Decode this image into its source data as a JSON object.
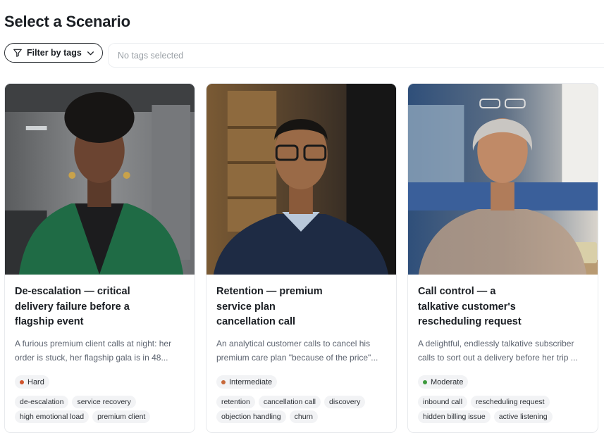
{
  "page": {
    "title": "Select a Scenario"
  },
  "filter": {
    "button_label": "Filter by tags",
    "placeholder": "No tags selected"
  },
  "colors": {
    "hard": "#d0542c",
    "intermediate": "#c7693a",
    "moderate": "#3d9a3d"
  },
  "cards": [
    {
      "title": "De-escalation — critical delivery failure before a flagship event",
      "description": "A furious premium client calls at night: her order is stuck, her flagship gala is in 48...",
      "difficulty": "Hard",
      "tags": [
        "de-escalation",
        "service recovery",
        "high emotional load",
        "premium client"
      ]
    },
    {
      "title": "Retention — premium service plan cancellation call",
      "description": "An analytical customer calls to cancel his premium care plan \"because of the price\"...",
      "difficulty": "Intermediate",
      "tags": [
        "retention",
        "cancellation call",
        "discovery",
        "objection handling",
        "churn"
      ]
    },
    {
      "title": "Call control — a talkative customer's rescheduling request",
      "description": "A delightful, endlessly talkative subscriber calls to sort out a delivery before her trip ...",
      "difficulty": "Moderate",
      "tags": [
        "inbound call",
        "rescheduling request",
        "hidden billing issue",
        "active listening"
      ]
    }
  ]
}
